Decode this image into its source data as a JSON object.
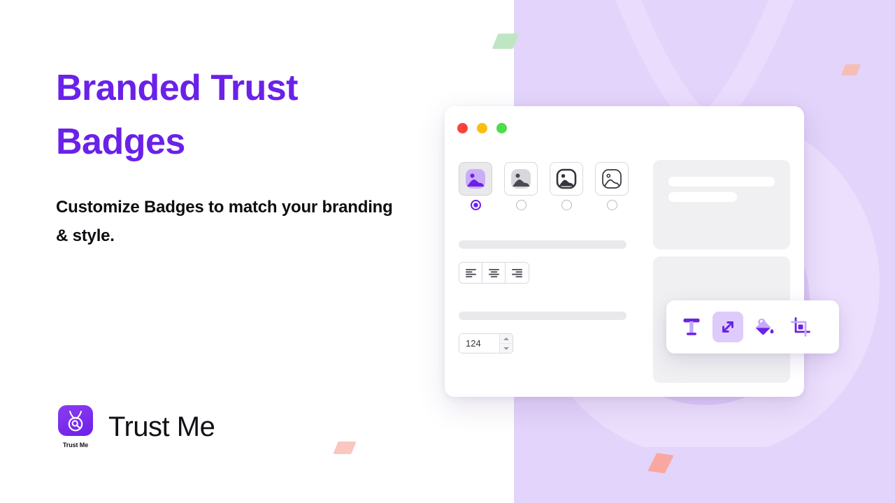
{
  "hero": {
    "headline": "Branded Trust Badges",
    "subheadline": "Customize Badges to match your branding & style."
  },
  "brand": {
    "name": "Trust Me",
    "badge_label": "Trust Me",
    "icon": "bug-magnifier-icon",
    "accent_color": "#6a21e8",
    "panel_color": "#e3d4fb"
  },
  "window": {
    "traffic_lights": [
      {
        "name": "close",
        "color": "#f8453c"
      },
      {
        "name": "minimize",
        "color": "#fbbd10"
      },
      {
        "name": "maximize",
        "color": "#4ddc4c"
      }
    ],
    "style_options": [
      {
        "icon": "image-filled-purple-icon",
        "selected": true
      },
      {
        "icon": "image-filled-gray-icon",
        "selected": false
      },
      {
        "icon": "image-outline-filled-icon",
        "selected": false
      },
      {
        "icon": "image-outline-icon",
        "selected": false
      }
    ],
    "align_buttons": [
      {
        "icon": "align-left-icon",
        "label": "Align left"
      },
      {
        "icon": "align-center-icon",
        "label": "Align center"
      },
      {
        "icon": "align-right-icon",
        "label": "Align right"
      }
    ],
    "number_field": {
      "value": "124",
      "increment_icon": "caret-up-icon",
      "decrement_icon": "caret-down-icon"
    },
    "toolbar": [
      {
        "icon": "text-tool-icon",
        "label": "Text",
        "active": false
      },
      {
        "icon": "resize-tool-icon",
        "label": "Resize",
        "active": true
      },
      {
        "icon": "paint-bucket-tool-icon",
        "label": "Fill",
        "active": false
      },
      {
        "icon": "crop-tool-icon",
        "label": "Crop",
        "active": false
      }
    ]
  },
  "decor": {
    "confetti": [
      {
        "name": "confetti-green",
        "color": "#bfe6c3"
      },
      {
        "name": "confetti-pink-1",
        "color": "#f9c6c0"
      },
      {
        "name": "confetti-pink-2",
        "color": "#f9a7a1"
      },
      {
        "name": "confetti-pink-3",
        "color": "#f6bdb5"
      },
      {
        "name": "confetti-pink-4",
        "color": "#f7c3bd"
      }
    ],
    "watermark": "trust-me-logo-watermark"
  }
}
